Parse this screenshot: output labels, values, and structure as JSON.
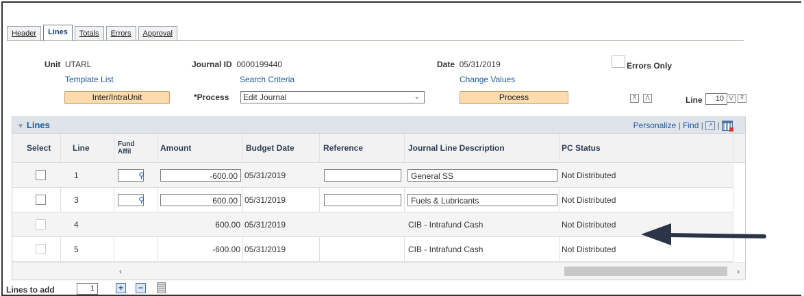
{
  "tabs": [
    {
      "label": "Header"
    },
    {
      "label": "Lines"
    },
    {
      "label": "Totals"
    },
    {
      "label": "Errors"
    },
    {
      "label": "Approval"
    }
  ],
  "header": {
    "unit_label": "Unit",
    "unit_value": "UTARL",
    "journal_id_label": "Journal ID",
    "journal_id_value": "0000199440",
    "date_label": "Date",
    "date_value": "05/31/2019",
    "errors_only_label": "Errors Only",
    "template_list": "Template List",
    "search_criteria": "Search Criteria",
    "change_values": "Change Values",
    "inter_intra_button": "Inter/IntraUnit",
    "process_label": "*Process",
    "process_value": "Edit Journal",
    "process_button": "Process",
    "line_label": "Line",
    "line_value": "10"
  },
  "grid": {
    "title": "Lines",
    "personalize": "Personalize",
    "find": "Find",
    "columns": {
      "select": "Select",
      "line": "Line",
      "fund_affil": "Fund Affil",
      "amount": "Amount",
      "budget_date": "Budget Date",
      "reference": "Reference",
      "description": "Journal Line Description",
      "pc_status": "PC Status"
    },
    "rows": [
      {
        "line": "1",
        "amount": "-600.00",
        "budget_date": "05/31/2019",
        "description": "General SS",
        "pc_status": "Not Distributed"
      },
      {
        "line": "3",
        "amount": "600.00",
        "budget_date": "05/31/2019",
        "description": "Fuels & Lubricants",
        "pc_status": "Not Distributed"
      },
      {
        "line": "4",
        "amount": "600.00",
        "budget_date": "05/31/2019",
        "description": "CIB - Intrafund Cash",
        "pc_status": "Not Distributed"
      },
      {
        "line": "5",
        "amount": "-600.00",
        "budget_date": "05/31/2019",
        "description": "CIB - Intrafund Cash",
        "pc_status": "Not Distributed"
      }
    ]
  },
  "footer": {
    "lines_to_add_label": "Lines to add",
    "lines_to_add_value": "1"
  },
  "colors": {
    "link": "#1d5a99",
    "button": "#fcdcae",
    "arrow": "#2b3547"
  }
}
